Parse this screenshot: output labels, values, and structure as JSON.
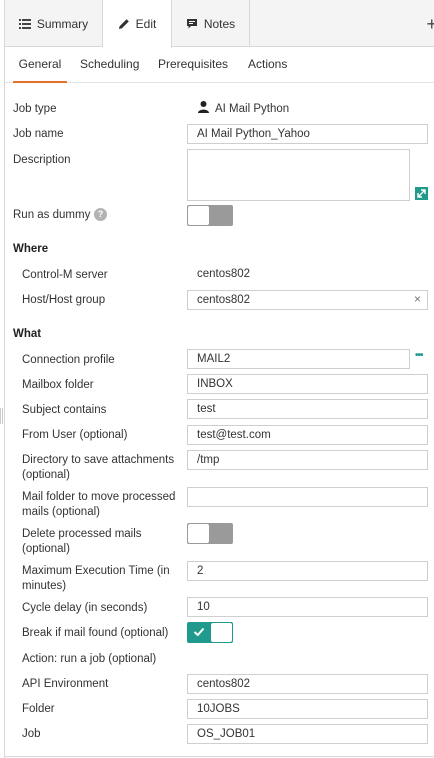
{
  "top_tabs": [
    {
      "label": "Summary",
      "icon": "list-icon"
    },
    {
      "label": "Edit",
      "icon": "pencil-icon"
    },
    {
      "label": "Notes",
      "icon": "speech-bubble-icon"
    }
  ],
  "add_label": "+",
  "sub_tabs": [
    "General",
    "Scheduling",
    "Prerequisites",
    "Actions"
  ],
  "general": {
    "job_type_label": "Job type",
    "job_type_value": "AI Mail Python",
    "job_name_label": "Job name",
    "job_name_value": "AI Mail Python_Yahoo",
    "description_label": "Description",
    "description_value": "",
    "run_as_dummy_label": "Run as dummy",
    "help_label": "?",
    "run_as_dummy_on": false
  },
  "where": {
    "heading": "Where",
    "control_m_server_label": "Control-M server",
    "control_m_server_value": "centos802",
    "host_group_label": "Host/Host group",
    "host_group_value": "centos802",
    "clear_label": "×"
  },
  "what": {
    "heading": "What",
    "connection_profile_label": "Connection profile",
    "connection_profile_value": "MAIL2",
    "more_label": "•••",
    "mailbox_folder_label": "Mailbox folder",
    "mailbox_folder_value": "INBOX",
    "subject_contains_label": "Subject contains",
    "subject_contains_value": "test",
    "from_user_label": "From User (optional)",
    "from_user_value": "test@test.com",
    "attachments_dir_label_1": "Directory to save attachments",
    "attachments_dir_label_2": "(optional)",
    "attachments_dir_value": "/tmp",
    "move_folder_label_1": "Mail folder to move processed",
    "move_folder_label_2": "mails (optional)",
    "move_folder_value": "",
    "delete_processed_label_1": "Delete processed mails",
    "delete_processed_label_2": "(optional)",
    "delete_processed_on": false,
    "max_exec_time_label_1": "Maximum Execution Time (in",
    "max_exec_time_label_2": "minutes)",
    "max_exec_time_value": "2",
    "cycle_delay_label": "Cycle delay (in seconds)",
    "cycle_delay_value": "10",
    "break_if_found_label": "Break if mail found (optional)",
    "break_if_found_on": true,
    "action_label": "Action: run a job (optional)",
    "api_env_label": "API Environment",
    "api_env_value": "centos802",
    "folder_label": "Folder",
    "folder_value": "10JOBS",
    "job_label": "Job",
    "job_value": "OS_JOB01"
  },
  "colors": {
    "accent": "#e8702a",
    "toggle_on": "#1f9a8c",
    "toggle_off": "#9a9a9a",
    "expand_icon": "#1f9a8c"
  }
}
